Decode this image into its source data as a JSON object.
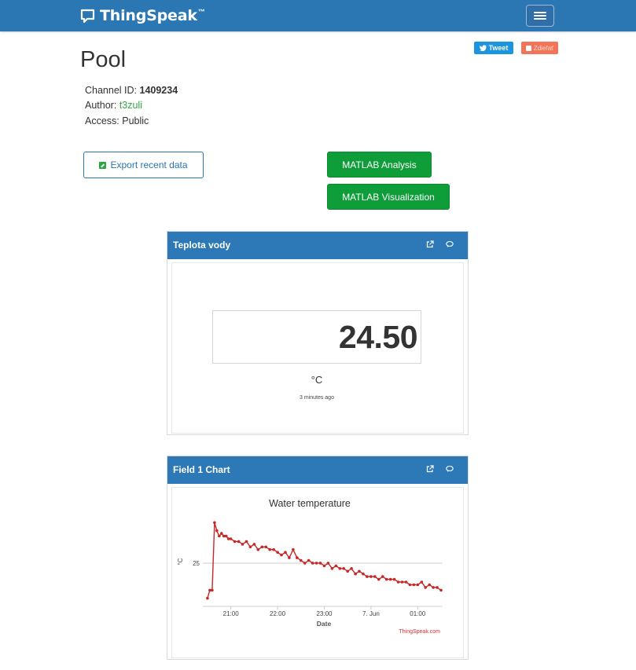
{
  "nav": {
    "brand": "ThingSpeak",
    "tm": "™"
  },
  "social": {
    "tweet": "Tweet",
    "share": "Zdieľať"
  },
  "channel": {
    "title": "Pool",
    "id_label": "Channel ID:",
    "id_value": "1409234",
    "author_label": "Author:",
    "author_value": "t3zuli",
    "access_label": "Access:",
    "access_value": "Public"
  },
  "buttons": {
    "export": "Export recent data",
    "matlab_analysis": "MATLAB Analysis",
    "matlab_visualization": "MATLAB Visualization"
  },
  "widget": {
    "title": "Teplota vody",
    "value": "24.50",
    "unit": "°C",
    "updated": "3 minutes ago"
  },
  "chart_panel": {
    "title": "Field 1 Chart"
  },
  "colors": {
    "navbar": "#2a77b3",
    "panel_header": "#2d78b6",
    "green": "#0f9d3a",
    "series": "#c62828"
  },
  "chart_data": {
    "type": "line",
    "title": "Water temperature",
    "xlabel": "Date",
    "ylabel": "°C",
    "x_ticks": [
      "21:00",
      "22:00",
      "23:00",
      "7. Jun",
      "01:00"
    ],
    "y_ticks": [
      25
    ],
    "credit": "ThingSpeak.com",
    "x": [
      "20:30",
      "20:33",
      "20:36",
      "20:39",
      "20:42",
      "20:45",
      "20:48",
      "20:51",
      "20:54",
      "20:57",
      "21:00",
      "21:05",
      "21:10",
      "21:15",
      "21:20",
      "21:25",
      "21:30",
      "21:35",
      "21:40",
      "21:45",
      "21:50",
      "21:55",
      "22:00",
      "22:05",
      "22:10",
      "22:15",
      "22:20",
      "22:25",
      "22:30",
      "22:35",
      "22:40",
      "22:45",
      "22:50",
      "22:55",
      "23:00",
      "23:05",
      "23:10",
      "23:15",
      "23:20",
      "23:25",
      "23:30",
      "23:35",
      "23:40",
      "23:45",
      "23:50",
      "23:55",
      "00:00",
      "00:05",
      "00:10",
      "00:15",
      "00:20",
      "00:25",
      "00:30",
      "00:35",
      "00:40",
      "00:45",
      "00:50",
      "00:55",
      "01:00",
      "01:05",
      "01:10",
      "01:15",
      "01:20",
      "01:25",
      "01:30"
    ],
    "y": [
      24.35,
      24.5,
      24.5,
      25.75,
      25.6,
      25.5,
      25.55,
      25.5,
      25.5,
      25.45,
      25.45,
      25.4,
      25.4,
      25.35,
      25.4,
      25.3,
      25.35,
      25.25,
      25.3,
      25.3,
      25.25,
      25.25,
      25.2,
      25.15,
      25.2,
      25.1,
      25.25,
      25.1,
      25.05,
      25.0,
      25.05,
      25.0,
      25.0,
      25.0,
      24.95,
      25.0,
      24.9,
      24.95,
      24.9,
      24.9,
      24.85,
      24.9,
      24.8,
      24.85,
      24.8,
      24.75,
      24.75,
      24.75,
      24.7,
      24.75,
      24.7,
      24.7,
      24.7,
      24.65,
      24.65,
      24.65,
      24.6,
      24.6,
      24.6,
      24.65,
      24.55,
      24.6,
      24.55,
      24.55,
      24.5
    ],
    "ylim": [
      24.2,
      25.9
    ],
    "grid": true,
    "legend": "none"
  }
}
